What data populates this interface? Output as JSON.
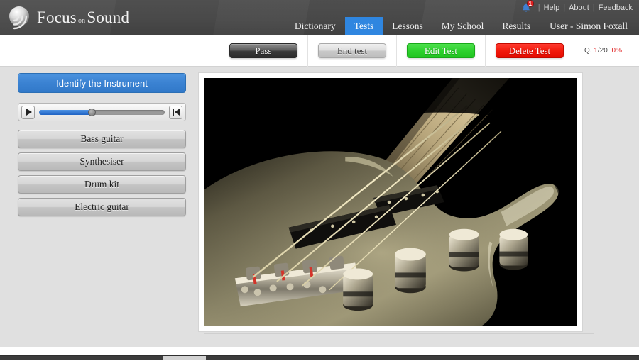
{
  "app": {
    "logo_main": "Focus",
    "logo_small": "on",
    "logo_end": "Sound"
  },
  "header": {
    "notification_count": "1",
    "bell_icon": "bell-icon",
    "utility_links": [
      {
        "label": "Help"
      },
      {
        "label": "About"
      },
      {
        "label": "Feedback"
      }
    ],
    "separator": "|",
    "nav": [
      {
        "label": "Dictionary",
        "active": false
      },
      {
        "label": "Tests",
        "active": true
      },
      {
        "label": "Lessons",
        "active": false
      },
      {
        "label": "My School",
        "active": false
      },
      {
        "label": "Results",
        "active": false
      },
      {
        "label": "User - Simon Foxall",
        "active": false
      }
    ],
    "accent_blue": "#2f86e0"
  },
  "toolbar": {
    "pass_label": "Pass",
    "end_test_label": "End test",
    "edit_test_label": "Edit Test",
    "delete_test_label": "Delete Test",
    "edit_color": "#2ed22e",
    "delete_color": "#f21a0c",
    "counter": {
      "prefix": "Q.",
      "current": "1",
      "total": "/20",
      "percent": "0%"
    }
  },
  "question": {
    "title": "Identify the Instrument",
    "player": {
      "play_icon": "play-icon",
      "restart_icon": "skip-to-start-icon",
      "progress_percent": 42,
      "fill_color": "#2e74cf"
    },
    "options": [
      {
        "label": "Bass guitar"
      },
      {
        "label": "Synthesiser"
      },
      {
        "label": "Drum kit"
      },
      {
        "label": "Electric guitar"
      }
    ]
  },
  "media": {
    "alt": "Close-up photograph of an olive-gold bass guitar body showing the bridge, four strings, two black pickups, four chrome knurled control knobs and the maple fretboard against a black background",
    "background": "#000000"
  }
}
